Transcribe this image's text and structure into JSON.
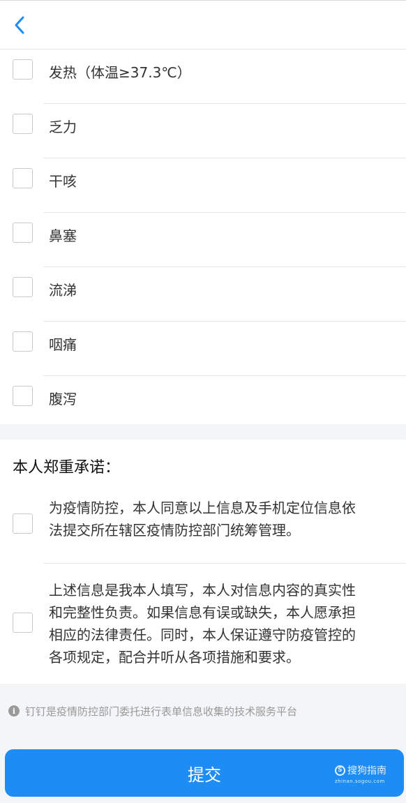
{
  "header": {
    "back_icon": "chevron-left-icon",
    "accent_color": "#1e8cf5"
  },
  "symptoms": [
    {
      "label": "发热（体温≥37.3℃）",
      "checked": false
    },
    {
      "label": "乏力",
      "checked": false
    },
    {
      "label": "干咳",
      "checked": false
    },
    {
      "label": "鼻塞",
      "checked": false
    },
    {
      "label": "流涕",
      "checked": false
    },
    {
      "label": "咽痛",
      "checked": false
    },
    {
      "label": "腹泻",
      "checked": false
    }
  ],
  "promise": {
    "title": "本人郑重承诺：",
    "items": [
      {
        "lines": [
          "为疫情防控，本人同意以上信息及手机定位信息依",
          "法提交所在辖区疫情防控部门统筹管理。"
        ],
        "checked": false
      },
      {
        "lines": [
          "上述信息是我本人填写，本人对信息内容的真实性",
          "和完整性负责。如果信息有误或缺失，本人愿承担",
          "相应的法律责任。同时，本人保证遵守防疫管控的",
          "各项规定，配合并听从各项措施和要求。"
        ],
        "checked": false
      }
    ]
  },
  "notice": {
    "icon": "info-icon",
    "icon_glyph": "i",
    "text": "钉钉是疫情防控部门委托进行表单信息收集的技术服务平台"
  },
  "submit": {
    "label": "提交",
    "color": "#1e8cf5"
  },
  "watermark": {
    "logo_glyph": "S",
    "name": "搜狗指南",
    "url": "zhinan.sogou.com"
  }
}
